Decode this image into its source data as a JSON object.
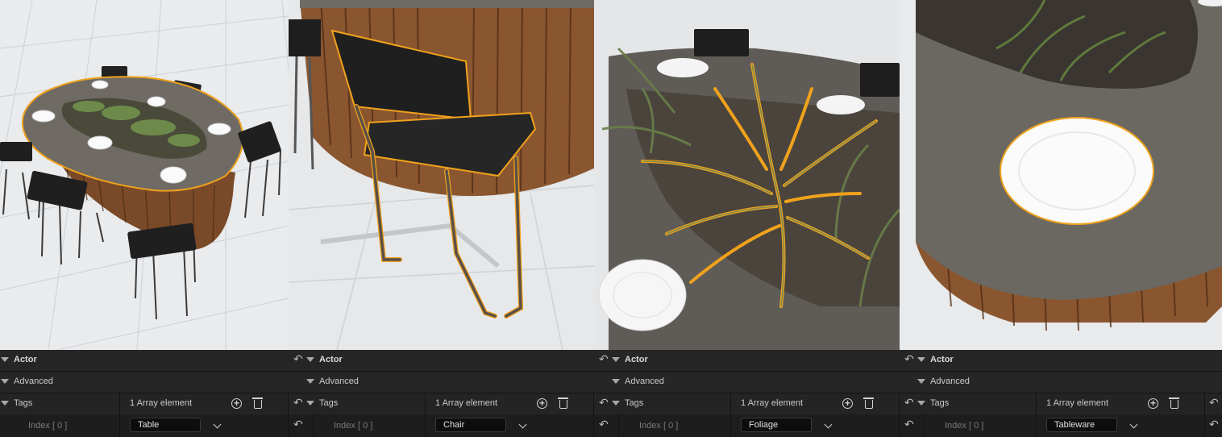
{
  "panels": [
    {
      "category_actor": "Actor",
      "category_advanced": "Advanced",
      "tags_label": "Tags",
      "array_count": "1 Array element",
      "index_label": "Index [ 0 ]",
      "tag_value": "Table"
    },
    {
      "category_actor": "Actor",
      "category_advanced": "Advanced",
      "tags_label": "Tags",
      "array_count": "1 Array element",
      "index_label": "Index [ 0 ]",
      "tag_value": "Chair"
    },
    {
      "category_actor": "Actor",
      "category_advanced": "Advanced",
      "tags_label": "Tags",
      "array_count": "1 Array element",
      "index_label": "Index [ 0 ]",
      "tag_value": "Foliage"
    },
    {
      "category_actor": "Actor",
      "category_advanced": "Advanced",
      "tags_label": "Tags",
      "array_count": "1 Array element",
      "index_label": "Index [ 0 ]",
      "tag_value": "Tableware"
    }
  ],
  "icons": {
    "add": "add-element-icon",
    "delete": "delete-all-icon",
    "reset": "reset-to-default-icon",
    "dropdown": "chevron-down-icon",
    "expand": "expand-triangle-icon"
  },
  "colors": {
    "selection_outline": "#f0a21c",
    "panel_bg": "#1a1a1a",
    "row_bg": "#262626",
    "field_bg": "#0d0d0d"
  }
}
